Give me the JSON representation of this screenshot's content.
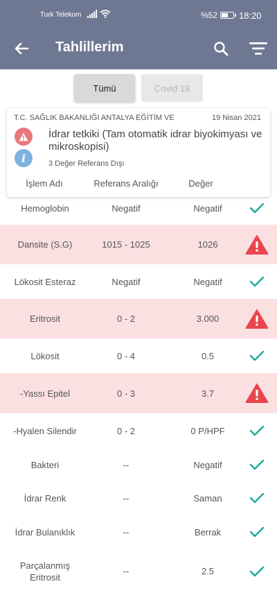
{
  "status_bar": {
    "carrier": "Turk Telekom",
    "battery_text": "%52",
    "battery_level": 0.52,
    "time": "18:20"
  },
  "app_bar": {
    "title": "Tahlillerim",
    "back_icon": "arrow-left-icon",
    "search_icon": "search-icon",
    "filter_icon": "filter-icon"
  },
  "tabs": [
    {
      "label": "Tümü",
      "active": true
    },
    {
      "label": "Covid 19",
      "active": false
    }
  ],
  "card": {
    "hospital": "T.C. SAĞLIK BAKANLIĞI ANTALYA EĞİTİM VE",
    "date": "19 Nisan 2021",
    "test_name": "İdrar tetkiki (Tam otomatik idrar biyokimyası ve mikroskopisi)",
    "out_of_range": "3 Değer Referans Dışı",
    "info_icon_text": "i",
    "columns": {
      "name": "İşlem Adı",
      "reference": "Referans Aralığı",
      "value": "Değer"
    }
  },
  "colors": {
    "app_bar": "#6f7893",
    "alert_row": "#fbe0e2",
    "warning_red": "#e8464e",
    "check_teal": "#1aa99a",
    "info_blue": "#7fb2de"
  },
  "results": [
    {
      "name": "Hemoglobin",
      "reference": "Negatif",
      "value": "Negatif",
      "status": "normal"
    },
    {
      "name": "Dansite (S.G)",
      "reference": "1015 - 1025",
      "value": "1026",
      "status": "alert"
    },
    {
      "name": "Lökosit Esteraz",
      "reference": "Negatif",
      "value": "Negatif",
      "status": "normal"
    },
    {
      "name": "Eritrosit",
      "reference": "0 - 2",
      "value": "3.000",
      "status": "alert"
    },
    {
      "name": "Lökosit",
      "reference": "0 - 4",
      "value": "0.5",
      "status": "normal"
    },
    {
      "name": "-Yassı Epitel",
      "reference": "0 - 3",
      "value": "3.7",
      "status": "alert"
    },
    {
      "name": "-Hyalen Silendir",
      "reference": "0 - 2",
      "value": "0 P/HPF",
      "status": "normal"
    },
    {
      "name": "Bakteri",
      "reference": "--",
      "value": "Negatif",
      "status": "normal"
    },
    {
      "name": "İdrar Renk",
      "reference": "--",
      "value": "Saman",
      "status": "normal"
    },
    {
      "name": "İdrar Bulanıklık",
      "reference": "--",
      "value": "Berrak",
      "status": "normal"
    },
    {
      "name": "Parçalanmış Eritrosit",
      "reference": "--",
      "value": "2.5",
      "status": "normal"
    }
  ]
}
